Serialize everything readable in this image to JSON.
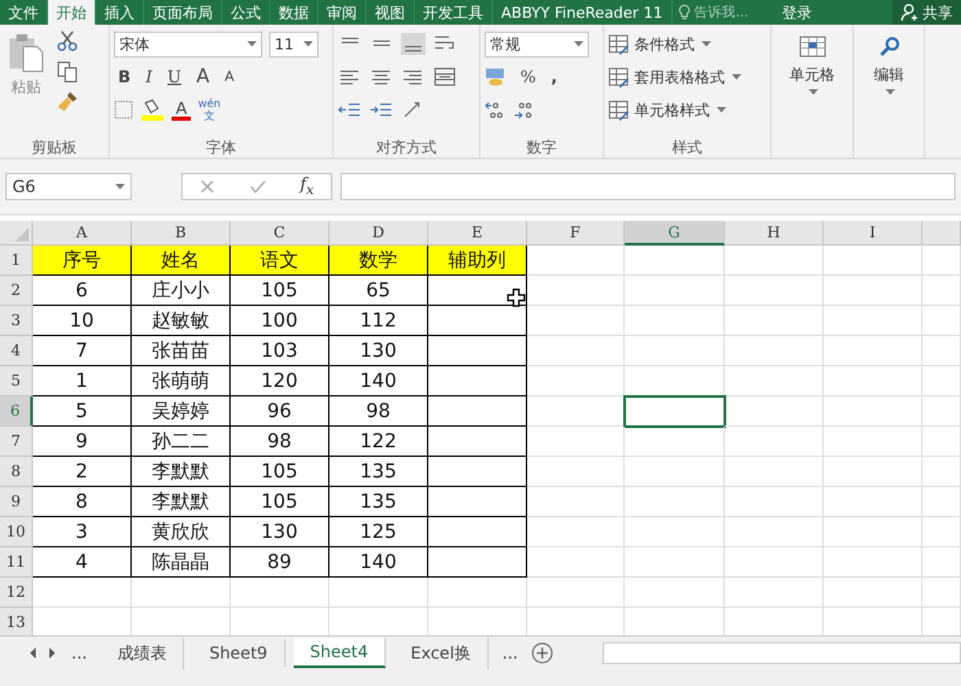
{
  "ribbon_tabs": [
    {
      "label": "文件",
      "selected": false
    },
    {
      "label": "开始",
      "selected": true
    },
    {
      "label": "插入",
      "selected": false
    },
    {
      "label": "页面布局",
      "selected": false
    },
    {
      "label": "公式",
      "selected": false
    },
    {
      "label": "数据",
      "selected": false
    },
    {
      "label": "审阅",
      "selected": false
    },
    {
      "label": "视图",
      "selected": false
    },
    {
      "label": "开发工具",
      "selected": false
    },
    {
      "label": "ABBYY FineReader 11",
      "selected": false
    }
  ],
  "tell_me": {
    "placeholder": "告诉我..."
  },
  "login": "登录",
  "share": "共享",
  "ribbon": {
    "clipboard": {
      "paste": "粘贴",
      "label": "剪贴板"
    },
    "font": {
      "name": "宋体",
      "size": "11",
      "bold": "B",
      "italic": "I",
      "underline": "U",
      "grow": "A",
      "shrink": "A",
      "phonetic_top": "wén",
      "phonetic_bottom": "文",
      "font_color": "A",
      "label": "字体"
    },
    "alignment": {
      "label": "对齐方式"
    },
    "number": {
      "format": "常规",
      "percent": "%",
      "comma": ",",
      "label": "数字"
    },
    "styles": {
      "items": [
        "条件格式",
        "套用表格格式",
        "单元格样式"
      ],
      "label": "样式"
    },
    "cells": {
      "label": "单元格"
    },
    "editing": {
      "label": "编辑"
    }
  },
  "formula_bar": {
    "name_box": "G6",
    "fx": "f$_{x}$"
  },
  "columns": [
    {
      "label": "A",
      "selected": false
    },
    {
      "label": "B",
      "selected": false
    },
    {
      "label": "C",
      "selected": false
    },
    {
      "label": "D",
      "selected": false
    },
    {
      "label": "E",
      "selected": false
    },
    {
      "label": "F",
      "selected": false
    },
    {
      "label": "G",
      "selected": true
    },
    {
      "label": "H",
      "selected": false
    },
    {
      "label": "I",
      "selected": false
    }
  ],
  "rows": [
    {
      "number": "1",
      "kind": "header",
      "selected": false,
      "cells": [
        "序号",
        "姓名",
        "语文",
        "数学",
        "辅助列"
      ]
    },
    {
      "number": "2",
      "kind": "data",
      "selected": false,
      "cells": [
        "6",
        "庄小小",
        "105",
        "65"
      ]
    },
    {
      "number": "3",
      "kind": "data",
      "selected": false,
      "cells": [
        "10",
        "赵敏敏",
        "100",
        "112"
      ]
    },
    {
      "number": "4",
      "kind": "data",
      "selected": false,
      "cells": [
        "7",
        "张苗苗",
        "103",
        "130"
      ]
    },
    {
      "number": "5",
      "kind": "data",
      "selected": false,
      "cells": [
        "1",
        "张萌萌",
        "120",
        "140"
      ]
    },
    {
      "number": "6",
      "kind": "data",
      "selected": true,
      "cells": [
        "5",
        "吴婷婷",
        "96",
        "98"
      ]
    },
    {
      "number": "7",
      "kind": "data",
      "selected": false,
      "cells": [
        "9",
        "孙二二",
        "98",
        "122"
      ]
    },
    {
      "number": "8",
      "kind": "data",
      "selected": false,
      "cells": [
        "2",
        "李默默",
        "105",
        "135"
      ]
    },
    {
      "number": "9",
      "kind": "data",
      "selected": false,
      "cells": [
        "8",
        "李默默",
        "105",
        "135"
      ]
    },
    {
      "number": "10",
      "kind": "data",
      "selected": false,
      "cells": [
        "3",
        "黄欣欣",
        "130",
        "125"
      ]
    },
    {
      "number": "11",
      "kind": "data",
      "selected": false,
      "cells": [
        "4",
        "陈晶晶",
        "89",
        "140"
      ]
    },
    {
      "number": "12",
      "kind": "empty",
      "selected": false,
      "cells": []
    },
    {
      "number": "13",
      "kind": "empty",
      "selected": false,
      "cells": []
    }
  ],
  "sheet_tabs": {
    "more_left": "...",
    "tabs": [
      {
        "label": "成绩表",
        "selected": false
      },
      {
        "label": "Sheet9",
        "selected": false
      },
      {
        "label": "Sheet4",
        "selected": true
      },
      {
        "label": "Excel换",
        "selected": false
      }
    ],
    "more_right": "..."
  }
}
